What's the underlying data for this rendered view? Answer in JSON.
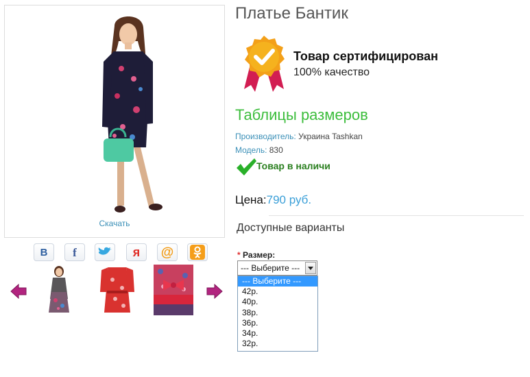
{
  "product": {
    "title": "Платье Бантик",
    "download_label": "Скачать"
  },
  "certificate": {
    "title": "Товар сертифицирован",
    "subtitle": "100% качество"
  },
  "size_tables_label": "Таблицы размеров",
  "manufacturer": {
    "label": "Производитель:",
    "value": "Украина Tashkan"
  },
  "model": {
    "label": "Модель:",
    "value": "830"
  },
  "stock_status": "Товар в наличи",
  "price": {
    "label": "Цена:",
    "value": "790 руб."
  },
  "variants_title": "Доступные варианты",
  "size_field": {
    "required_mark": "*",
    "label": "Размер:",
    "selected": "--- Выберите ---",
    "options": [
      "--- Выберите ---",
      "42р.",
      "40р.",
      "38р.",
      "36р.",
      "34р.",
      "32р."
    ]
  },
  "social_icons": [
    "vk-icon",
    "facebook-icon",
    "twitter-icon",
    "yandex-icon",
    "mail-icon",
    "odnoklassniki-icon"
  ],
  "colors": {
    "accent_green": "#3cbd3c",
    "link_blue": "#3a8fb7",
    "price_blue": "#3a9fd8",
    "arrow_magenta": "#b2247f",
    "select_highlight": "#3399ff"
  }
}
